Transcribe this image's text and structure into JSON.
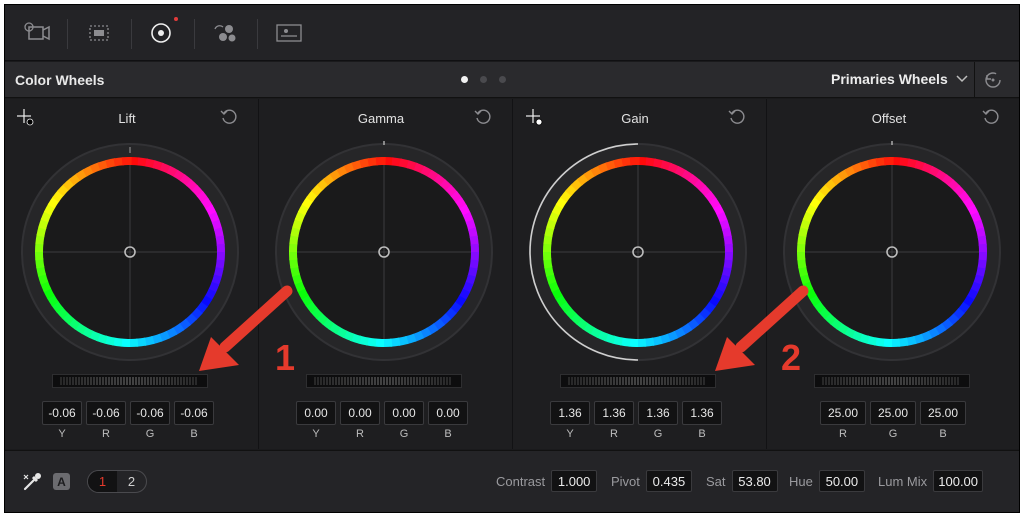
{
  "toolbar": {
    "icons": [
      "camera-raw-icon",
      "color-match-icon",
      "color-wheels-icon",
      "rgb-mixer-icon",
      "motion-effects-icon"
    ]
  },
  "panel": {
    "title": "Color Wheels",
    "mode": "Primaries Wheels",
    "pages_total": 3,
    "active_page": 1
  },
  "wheels": [
    {
      "name": "Lift",
      "values": [
        "-0.06",
        "-0.06",
        "-0.06",
        "-0.06"
      ],
      "channels": [
        "Y",
        "R",
        "G",
        "B"
      ]
    },
    {
      "name": "Gamma",
      "values": [
        "0.00",
        "0.00",
        "0.00",
        "0.00"
      ],
      "channels": [
        "Y",
        "R",
        "G",
        "B"
      ]
    },
    {
      "name": "Gain",
      "values": [
        "1.36",
        "1.36",
        "1.36",
        "1.36"
      ],
      "channels": [
        "Y",
        "R",
        "G",
        "B"
      ]
    },
    {
      "name": "Offset",
      "values": [
        "25.00",
        "25.00",
        "25.00"
      ],
      "channels": [
        "R",
        "G",
        "B"
      ]
    }
  ],
  "annotations": [
    "1",
    "2"
  ],
  "bottom": {
    "auto_label": "A",
    "pages": [
      "1",
      "2"
    ],
    "params": [
      {
        "label": "Contrast",
        "value": "1.000"
      },
      {
        "label": "Pivot",
        "value": "0.435"
      },
      {
        "label": "Sat",
        "value": "53.80"
      },
      {
        "label": "Hue",
        "value": "50.00"
      },
      {
        "label": "Lum Mix",
        "value": "100.00"
      }
    ]
  },
  "colors": {
    "accent": "#e53a2c",
    "panel_bg": "#1e1e20"
  }
}
